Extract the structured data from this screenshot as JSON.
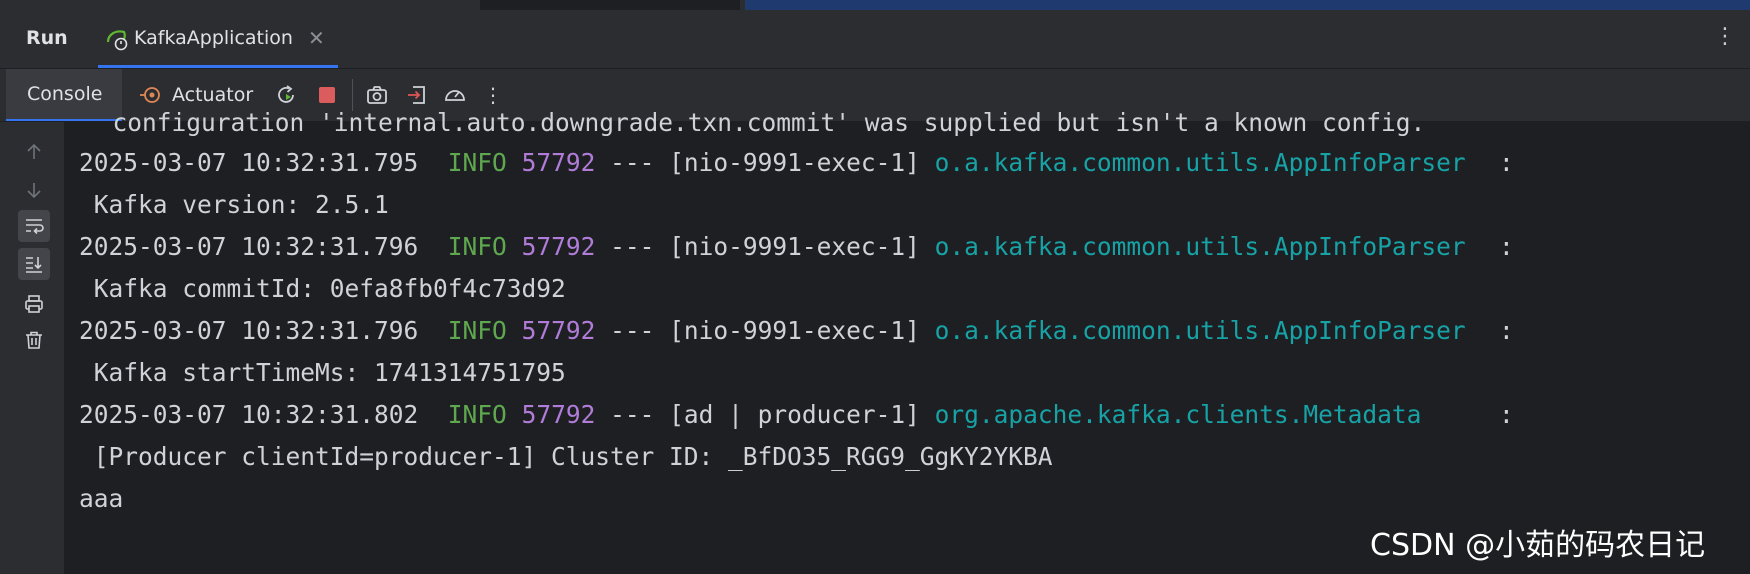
{
  "run_panel": {
    "title": "Run",
    "tab": {
      "label": "KafkaApplication"
    }
  },
  "toolbar": {
    "console_tab": "Console",
    "actuator_tab": "Actuator"
  },
  "console": {
    "colors": {
      "level": "#5fa84f",
      "pid": "#b07cd8",
      "logger": "#17a2a6",
      "text": "#cfd2d6"
    },
    "first_line": "  configuration 'internal.auto.downgrade.txn.commit' was supplied but isn't a known config.",
    "entries": [
      {
        "timestamp": "2025-03-07 10:32:31.795",
        "level": "INFO",
        "pid": "57792",
        "thread": "--- [nio-9991-exec-1]",
        "logger": "o.a.kafka.common.utils.AppInfoParser",
        "message": " Kafka version: 2.5.1"
      },
      {
        "timestamp": "2025-03-07 10:32:31.796",
        "level": "INFO",
        "pid": "57792",
        "thread": "--- [nio-9991-exec-1]",
        "logger": "o.a.kafka.common.utils.AppInfoParser",
        "message": " Kafka commitId: 0efa8fb0f4c73d92"
      },
      {
        "timestamp": "2025-03-07 10:32:31.796",
        "level": "INFO",
        "pid": "57792",
        "thread": "--- [nio-9991-exec-1]",
        "logger": "o.a.kafka.common.utils.AppInfoParser",
        "message": " Kafka startTimeMs: 1741314751795"
      },
      {
        "timestamp": "2025-03-07 10:32:31.802",
        "level": "INFO",
        "pid": "57792",
        "thread": "--- [ad | producer-1]",
        "logger": "org.apache.kafka.clients.Metadata",
        "message": " [Producer clientId=producer-1] Cluster ID: _BfDO35_RGG9_GgKY2YKBA"
      }
    ],
    "last_line": "aaa",
    "separator": ":"
  },
  "watermark": "CSDN @小茹的码农日记"
}
